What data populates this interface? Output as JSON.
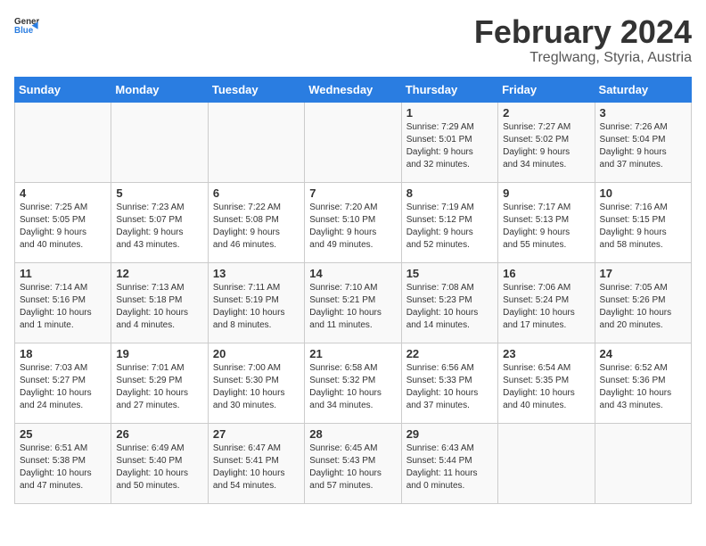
{
  "app": {
    "name_general": "General",
    "name_blue": "Blue"
  },
  "header": {
    "title": "February 2024",
    "subtitle": "Treglwang, Styria, Austria"
  },
  "calendar": {
    "days_of_week": [
      "Sunday",
      "Monday",
      "Tuesday",
      "Wednesday",
      "Thursday",
      "Friday",
      "Saturday"
    ],
    "weeks": [
      [
        {
          "day": "",
          "info": ""
        },
        {
          "day": "",
          "info": ""
        },
        {
          "day": "",
          "info": ""
        },
        {
          "day": "",
          "info": ""
        },
        {
          "day": "1",
          "info": "Sunrise: 7:29 AM\nSunset: 5:01 PM\nDaylight: 9 hours\nand 32 minutes."
        },
        {
          "day": "2",
          "info": "Sunrise: 7:27 AM\nSunset: 5:02 PM\nDaylight: 9 hours\nand 34 minutes."
        },
        {
          "day": "3",
          "info": "Sunrise: 7:26 AM\nSunset: 5:04 PM\nDaylight: 9 hours\nand 37 minutes."
        }
      ],
      [
        {
          "day": "4",
          "info": "Sunrise: 7:25 AM\nSunset: 5:05 PM\nDaylight: 9 hours\nand 40 minutes."
        },
        {
          "day": "5",
          "info": "Sunrise: 7:23 AM\nSunset: 5:07 PM\nDaylight: 9 hours\nand 43 minutes."
        },
        {
          "day": "6",
          "info": "Sunrise: 7:22 AM\nSunset: 5:08 PM\nDaylight: 9 hours\nand 46 minutes."
        },
        {
          "day": "7",
          "info": "Sunrise: 7:20 AM\nSunset: 5:10 PM\nDaylight: 9 hours\nand 49 minutes."
        },
        {
          "day": "8",
          "info": "Sunrise: 7:19 AM\nSunset: 5:12 PM\nDaylight: 9 hours\nand 52 minutes."
        },
        {
          "day": "9",
          "info": "Sunrise: 7:17 AM\nSunset: 5:13 PM\nDaylight: 9 hours\nand 55 minutes."
        },
        {
          "day": "10",
          "info": "Sunrise: 7:16 AM\nSunset: 5:15 PM\nDaylight: 9 hours\nand 58 minutes."
        }
      ],
      [
        {
          "day": "11",
          "info": "Sunrise: 7:14 AM\nSunset: 5:16 PM\nDaylight: 10 hours\nand 1 minute."
        },
        {
          "day": "12",
          "info": "Sunrise: 7:13 AM\nSunset: 5:18 PM\nDaylight: 10 hours\nand 4 minutes."
        },
        {
          "day": "13",
          "info": "Sunrise: 7:11 AM\nSunset: 5:19 PM\nDaylight: 10 hours\nand 8 minutes."
        },
        {
          "day": "14",
          "info": "Sunrise: 7:10 AM\nSunset: 5:21 PM\nDaylight: 10 hours\nand 11 minutes."
        },
        {
          "day": "15",
          "info": "Sunrise: 7:08 AM\nSunset: 5:23 PM\nDaylight: 10 hours\nand 14 minutes."
        },
        {
          "day": "16",
          "info": "Sunrise: 7:06 AM\nSunset: 5:24 PM\nDaylight: 10 hours\nand 17 minutes."
        },
        {
          "day": "17",
          "info": "Sunrise: 7:05 AM\nSunset: 5:26 PM\nDaylight: 10 hours\nand 20 minutes."
        }
      ],
      [
        {
          "day": "18",
          "info": "Sunrise: 7:03 AM\nSunset: 5:27 PM\nDaylight: 10 hours\nand 24 minutes."
        },
        {
          "day": "19",
          "info": "Sunrise: 7:01 AM\nSunset: 5:29 PM\nDaylight: 10 hours\nand 27 minutes."
        },
        {
          "day": "20",
          "info": "Sunrise: 7:00 AM\nSunset: 5:30 PM\nDaylight: 10 hours\nand 30 minutes."
        },
        {
          "day": "21",
          "info": "Sunrise: 6:58 AM\nSunset: 5:32 PM\nDaylight: 10 hours\nand 34 minutes."
        },
        {
          "day": "22",
          "info": "Sunrise: 6:56 AM\nSunset: 5:33 PM\nDaylight: 10 hours\nand 37 minutes."
        },
        {
          "day": "23",
          "info": "Sunrise: 6:54 AM\nSunset: 5:35 PM\nDaylight: 10 hours\nand 40 minutes."
        },
        {
          "day": "24",
          "info": "Sunrise: 6:52 AM\nSunset: 5:36 PM\nDaylight: 10 hours\nand 43 minutes."
        }
      ],
      [
        {
          "day": "25",
          "info": "Sunrise: 6:51 AM\nSunset: 5:38 PM\nDaylight: 10 hours\nand 47 minutes."
        },
        {
          "day": "26",
          "info": "Sunrise: 6:49 AM\nSunset: 5:40 PM\nDaylight: 10 hours\nand 50 minutes."
        },
        {
          "day": "27",
          "info": "Sunrise: 6:47 AM\nSunset: 5:41 PM\nDaylight: 10 hours\nand 54 minutes."
        },
        {
          "day": "28",
          "info": "Sunrise: 6:45 AM\nSunset: 5:43 PM\nDaylight: 10 hours\nand 57 minutes."
        },
        {
          "day": "29",
          "info": "Sunrise: 6:43 AM\nSunset: 5:44 PM\nDaylight: 11 hours\nand 0 minutes."
        },
        {
          "day": "",
          "info": ""
        },
        {
          "day": "",
          "info": ""
        }
      ]
    ]
  }
}
